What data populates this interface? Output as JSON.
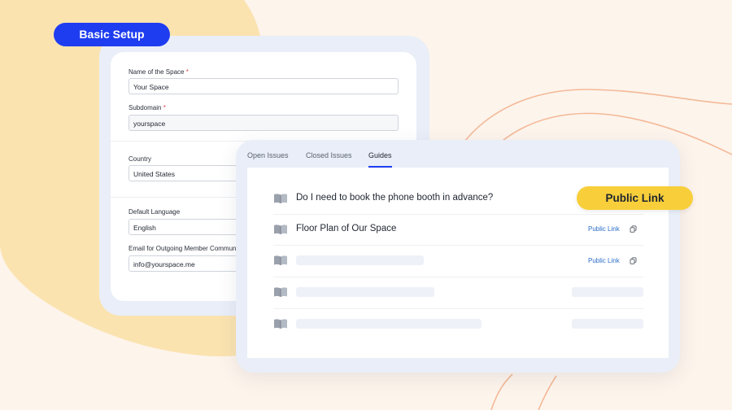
{
  "colors": {
    "background": "#fdf4ec",
    "blob": "#fbe3b0",
    "accent_blue": "#1f3df0",
    "accent_yellow": "#f8cf3a",
    "link": "#2a6cc9",
    "curve": "#f3b997"
  },
  "badges": {
    "basic_setup": "Basic Setup",
    "public_link": "Public Link"
  },
  "setup_form": {
    "fields": [
      {
        "label": "Name of the Space",
        "required": "*",
        "value": "Your Space"
      },
      {
        "label": "Subdomain",
        "required": "*",
        "value": "yourspace"
      },
      {
        "label": "Country",
        "value": "United States"
      },
      {
        "label": "Default Language",
        "value": "English"
      },
      {
        "label": "Email for Outgoing Member Communications",
        "value": "info@yourspace.me"
      }
    ]
  },
  "guides_panel": {
    "tabs": [
      {
        "label": "Open Issues"
      },
      {
        "label": "Closed Issues"
      },
      {
        "label": "Guides",
        "active": true
      }
    ],
    "rows": [
      {
        "title": "Do I need to book the phone booth in advance?",
        "icon": "book-icon"
      },
      {
        "title": "Floor Plan of Our Space",
        "link": "Public Link",
        "icon": "book-icon"
      },
      {
        "title": "",
        "link": "Public Link",
        "icon": "book-icon"
      },
      {
        "title": "",
        "icon": "book-icon"
      },
      {
        "title": "",
        "icon": "book-icon"
      }
    ]
  }
}
